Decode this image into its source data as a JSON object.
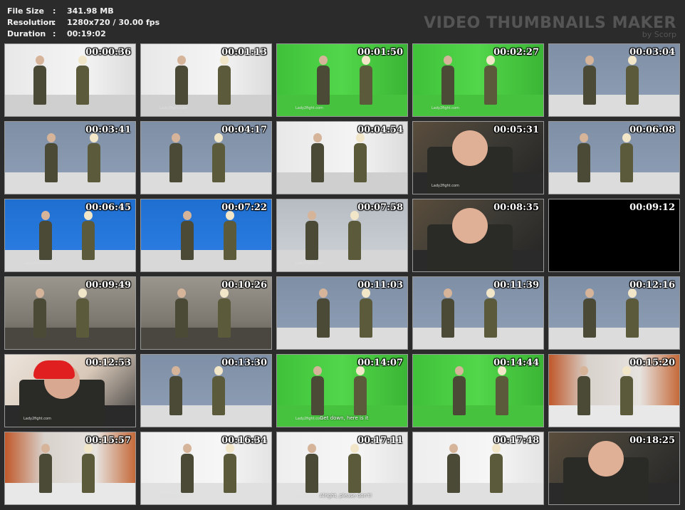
{
  "meta": {
    "file_size_key": "File Size",
    "file_size_val": "341.98 MB",
    "resolution_key": "Resolution",
    "resolution_val": "1280x720 / 30.00 fps",
    "duration_key": "Duration",
    "duration_val": "00:19:02",
    "sep": ":"
  },
  "brand": {
    "title": "VIDEO THUMBNAILS MAKER",
    "sub": "by Scorp"
  },
  "thumbs": [
    {
      "ts": "00:00:36",
      "scene": "room-white",
      "wm": ""
    },
    {
      "ts": "00:01:13",
      "scene": "room-white",
      "wm": "Lady2fight.com"
    },
    {
      "ts": "00:01:50",
      "scene": "green",
      "wm": "Lady2fight.com"
    },
    {
      "ts": "00:02:27",
      "scene": "green",
      "wm": "Lady2fight.com"
    },
    {
      "ts": "00:03:04",
      "scene": "blue-wall",
      "wm": ""
    },
    {
      "ts": "00:03:41",
      "scene": "blue-wall",
      "wm": "Lady2fight.com"
    },
    {
      "ts": "00:04:17",
      "scene": "blue-wall",
      "wm": "Lady2fight.com"
    },
    {
      "ts": "00:04:54",
      "scene": "room-white",
      "wm": ""
    },
    {
      "ts": "00:05:31",
      "scene": "closeup",
      "wm": "Lady2fight.com"
    },
    {
      "ts": "00:06:08",
      "scene": "blue-wall",
      "wm": "Lady2fight.com"
    },
    {
      "ts": "00:06:45",
      "scene": "blue",
      "wm": "Lady2fight.com"
    },
    {
      "ts": "00:07:22",
      "scene": "blue",
      "wm": ""
    },
    {
      "ts": "00:07:58",
      "scene": "grey",
      "wm": "Lady2fight.com"
    },
    {
      "ts": "00:08:35",
      "scene": "closeup",
      "wm": ""
    },
    {
      "ts": "00:09:12",
      "scene": "black",
      "wm": ""
    },
    {
      "ts": "00:09:49",
      "scene": "stairs",
      "wm": ""
    },
    {
      "ts": "00:10:26",
      "scene": "stairs",
      "wm": ""
    },
    {
      "ts": "00:11:03",
      "scene": "blue-wall",
      "wm": ""
    },
    {
      "ts": "00:11:39",
      "scene": "blue-wall",
      "wm": ""
    },
    {
      "ts": "00:12:16",
      "scene": "blue-wall",
      "wm": ""
    },
    {
      "ts": "00:12:53",
      "scene": "closeup-red",
      "wm": "Lady2fight.com"
    },
    {
      "ts": "00:13:30",
      "scene": "blue-wall",
      "wm": ""
    },
    {
      "ts": "00:14:07",
      "scene": "green",
      "wm": "Lady2fight.com",
      "caption": "Get down, here is it"
    },
    {
      "ts": "00:14:44",
      "scene": "green",
      "wm": ""
    },
    {
      "ts": "00:15:20",
      "scene": "orange",
      "wm": ""
    },
    {
      "ts": "00:15:57",
      "scene": "orange",
      "wm": ""
    },
    {
      "ts": "00:16:34",
      "scene": "office",
      "wm": "Lady2fight.com"
    },
    {
      "ts": "00:17:11",
      "scene": "office",
      "wm": "Lady2fight.com",
      "caption": "Alright, please don't!"
    },
    {
      "ts": "00:17:48",
      "scene": "office",
      "wm": ""
    },
    {
      "ts": "00:18:25",
      "scene": "closeup",
      "wm": ""
    }
  ],
  "colors": {
    "background": "#2b2b2b",
    "timestamp": "#ffffff",
    "header_text": "#f0f0f0",
    "brand": "#555555"
  }
}
